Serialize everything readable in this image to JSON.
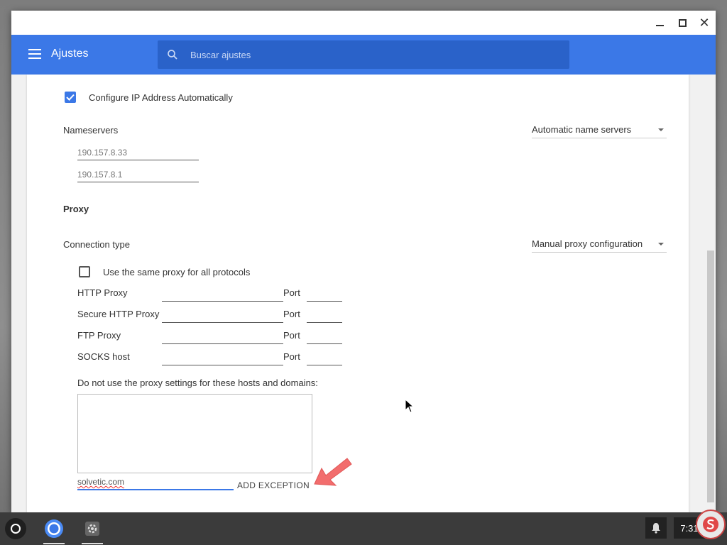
{
  "app": {
    "title": "Ajustes",
    "search_placeholder": "Buscar ajustes"
  },
  "network": {
    "auto_ip_label": "Configure IP Address Automatically",
    "auto_ip_checked": true,
    "nameservers_label": "Nameservers",
    "nameservers_mode": "Automatic name servers",
    "nameserver_values": [
      "190.157.8.33",
      "190.157.8.1"
    ]
  },
  "proxy": {
    "section_title": "Proxy",
    "connection_type_label": "Connection type",
    "connection_type_value": "Manual proxy configuration",
    "same_proxy_label": "Use the same proxy for all protocols",
    "same_proxy_checked": false,
    "rows": [
      {
        "label": "HTTP Proxy",
        "port_label": "Port"
      },
      {
        "label": "Secure HTTP Proxy",
        "port_label": "Port"
      },
      {
        "label": "FTP Proxy",
        "port_label": "Port"
      },
      {
        "label": "SOCKS host",
        "port_label": "Port"
      }
    ],
    "exceptions_label": "Do not use the proxy settings for these hosts and domains:",
    "exception_input_value": "solvetic.com",
    "add_exception_label": "ADD EXCEPTION"
  },
  "shelf": {
    "clock": "7:31"
  },
  "colors": {
    "accent": "#3b78e7",
    "annotation_arrow": "#f26d6d"
  }
}
